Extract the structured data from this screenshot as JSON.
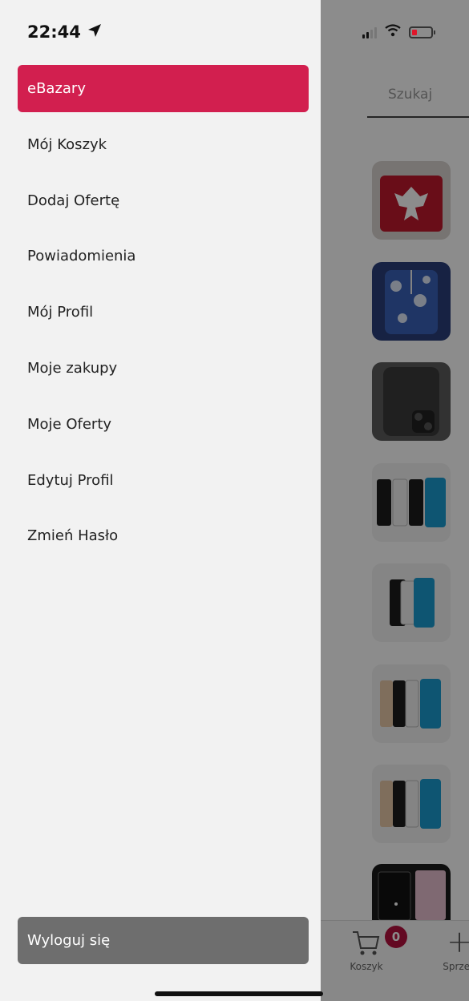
{
  "status_bar": {
    "time": "22:44"
  },
  "background": {
    "search_label": "Szukaj",
    "tabs": {
      "cart_label": "Koszyk",
      "cart_count": "0",
      "sell_label": "Sprzed"
    }
  },
  "drawer": {
    "items": [
      {
        "label": "eBazary",
        "active": true
      },
      {
        "label": "Mój Koszyk"
      },
      {
        "label": "Dodaj Ofertę"
      },
      {
        "label": "Powiadomienia"
      },
      {
        "label": "Mój Profil"
      },
      {
        "label": "Moje zakupy"
      },
      {
        "label": "Moje Oferty"
      },
      {
        "label": "Edytuj Profil"
      },
      {
        "label": "Zmień Hasło"
      }
    ],
    "logout_label": "Wyloguj się"
  },
  "colors": {
    "accent": "#d21f4f",
    "logout": "#6e6e6e",
    "badge": "#b5123f"
  }
}
